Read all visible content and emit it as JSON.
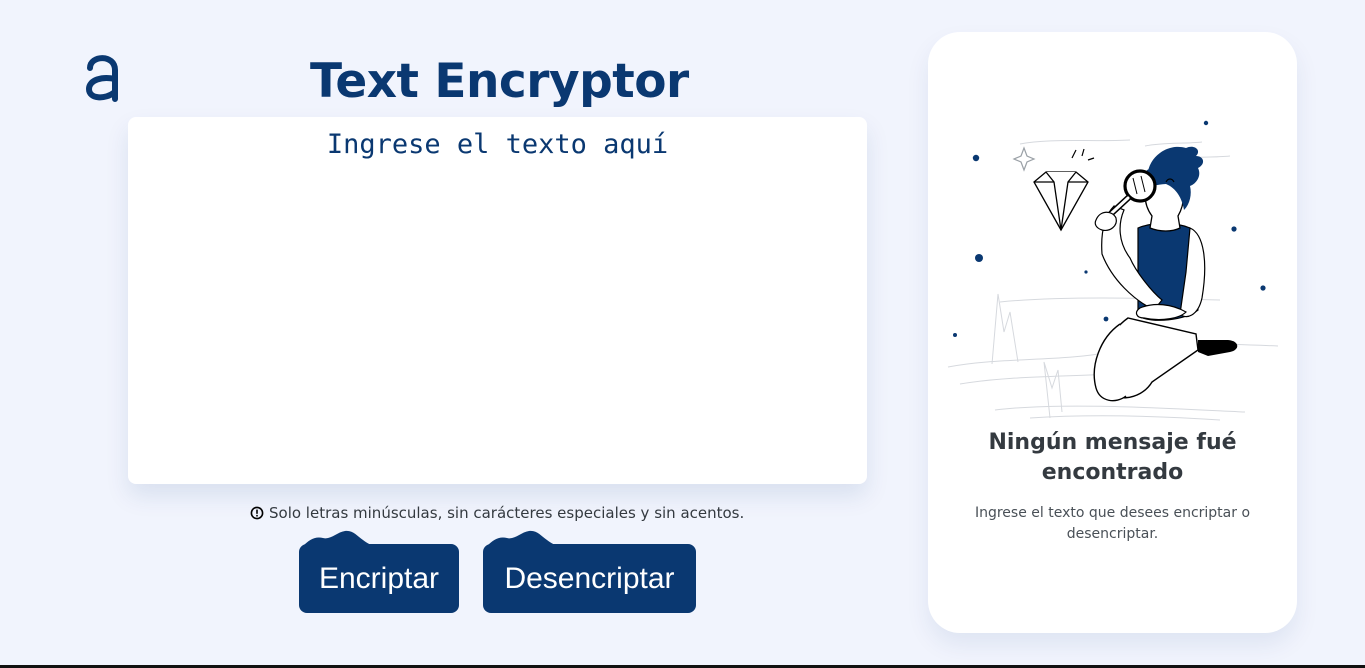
{
  "header": {
    "title": "Text Encryptor",
    "logo_icon": "alura-logo-icon"
  },
  "editor": {
    "placeholder": "Ingrese el texto aquí",
    "value": ""
  },
  "hint": {
    "icon": "exclamation-circle-icon",
    "text": "Solo letras minúsculas, sin carácteres especiales y sin acentos."
  },
  "actions": {
    "encrypt_label": "Encriptar",
    "decrypt_label": "Desencriptar"
  },
  "result_panel": {
    "illustration": "person-with-magnifying-glass-and-diamond",
    "title": "Ningún mensaje fué encontrado",
    "text": "Ingrese el texto que desees encriptar o desencriptar."
  },
  "colors": {
    "background": "#f1f4fd",
    "primary": "#0a3871",
    "card": "#ffffff",
    "text_dark": "#343a40",
    "text_muted": "#495057"
  }
}
